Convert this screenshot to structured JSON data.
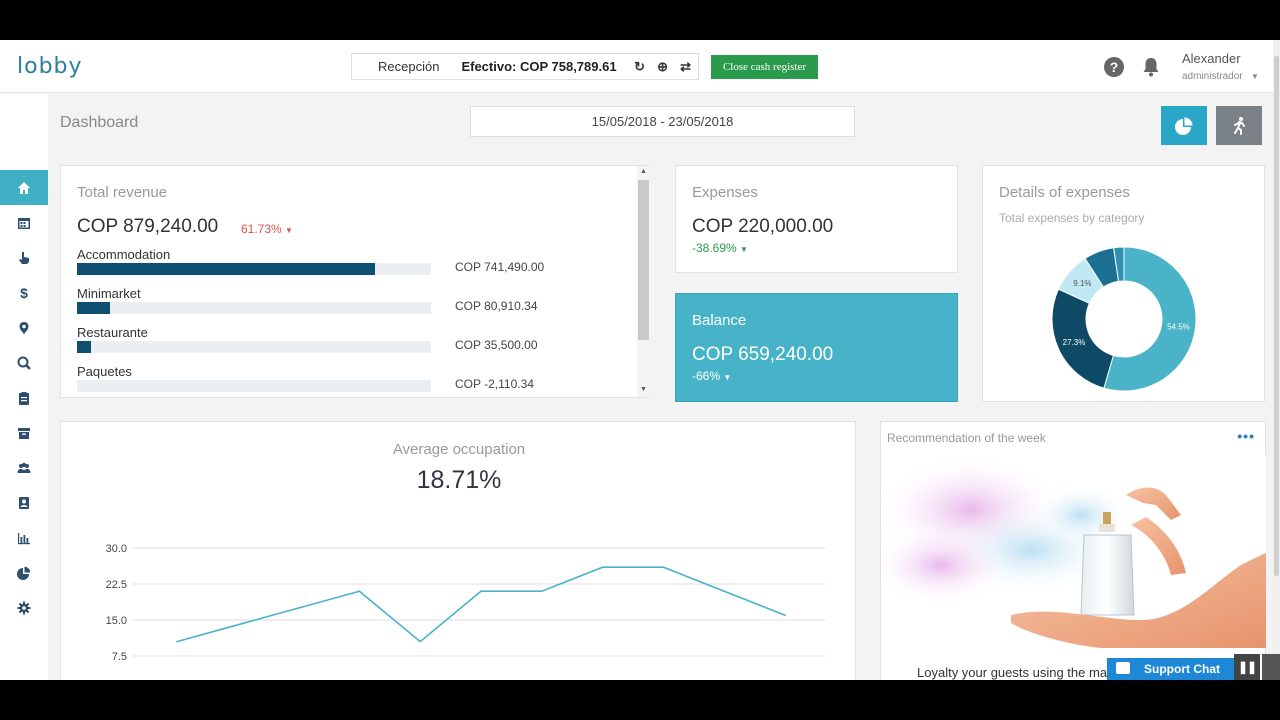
{
  "app": {
    "logo": "lobby",
    "register_name": "Recepción",
    "cash_label": "Efectivo: COP 758,789.61",
    "close_button": "Close cash register",
    "user_name": "Alexander",
    "user_role": "administrador",
    "support_chat": "Support Chat"
  },
  "icons": {
    "refresh": "refresh-icon",
    "add": "plus-circle-icon",
    "transfer": "transfer-icon",
    "help": "question-circle-icon",
    "bell": "bell-icon",
    "pie": "pie-chart-icon",
    "exit": "running-person-icon"
  },
  "sidebar": {
    "items": [
      {
        "name": "home",
        "active": true
      },
      {
        "name": "calendar"
      },
      {
        "name": "pointer"
      },
      {
        "name": "dollar"
      },
      {
        "name": "map-marker"
      },
      {
        "name": "search"
      },
      {
        "name": "clipboard"
      },
      {
        "name": "archive"
      },
      {
        "name": "users"
      },
      {
        "name": "contact"
      },
      {
        "name": "bar-chart"
      },
      {
        "name": "pie-chart"
      },
      {
        "name": "settings"
      }
    ]
  },
  "dashboard": {
    "title": "Dashboard",
    "date_range": "15/05/2018 - 23/05/2018"
  },
  "revenue": {
    "title": "Total revenue",
    "value": "COP 879,240.00",
    "trend": "61.73%",
    "rows": [
      {
        "label": "Accommodation",
        "amount": "COP 741,490.00",
        "fraction": 0.843
      },
      {
        "label": "Minimarket",
        "amount": "COP 80,910.34",
        "fraction": 0.092
      },
      {
        "label": "Restaurante",
        "amount": "COP 35,500.00",
        "fraction": 0.04
      },
      {
        "label": "Paquetes",
        "amount": "COP -2,110.34",
        "fraction": 0.0
      }
    ]
  },
  "expenses": {
    "title": "Expenses",
    "value": "COP 220,000.00",
    "trend": "-38.69%"
  },
  "balance": {
    "title": "Balance",
    "value": "COP 659,240.00",
    "trend": "-66%"
  },
  "details": {
    "title": "Details of expenses",
    "subtitle": "Total expenses by category"
  },
  "occupation": {
    "title": "Average occupation",
    "value": "18.71%"
  },
  "recommendation": {
    "title": "Recommendation of the week",
    "text": "Loyalty your guests using the mark"
  },
  "colors": {
    "accent": "#3fb0c3",
    "navy": "#0f4f6f",
    "green": "#2a9b4c",
    "red": "#d9534f"
  },
  "chart_data": [
    {
      "type": "pie",
      "title": "Details of expenses",
      "labels": [
        "54.5%",
        "27.3%",
        "9.1%",
        "",
        ""
      ],
      "values": [
        54.5,
        27.3,
        9.1,
        6.8,
        2.3
      ],
      "colors": [
        "#4ab3c7",
        "#0e4a66",
        "#bfe8f3",
        "#1b6f93",
        "#2f90b5"
      ],
      "donut": true
    },
    {
      "type": "line",
      "title": "",
      "x": [
        1,
        2,
        3,
        4,
        5,
        6,
        7,
        8,
        9,
        10,
        11
      ],
      "series": [
        {
          "values": [
            10.5,
            14.0,
            17.5,
            21.0,
            10.5,
            21.0,
            21.0,
            26.0,
            26.0,
            21.0,
            16.0
          ],
          "color": "#4ab3c7"
        }
      ],
      "ylim": [
        7.5,
        30.0
      ],
      "yticks": [
        "30.0",
        "22.5",
        "15.0",
        "7.5"
      ],
      "ytick_values": [
        30.0,
        22.5,
        15.0,
        7.5
      ],
      "grid": true
    }
  ]
}
